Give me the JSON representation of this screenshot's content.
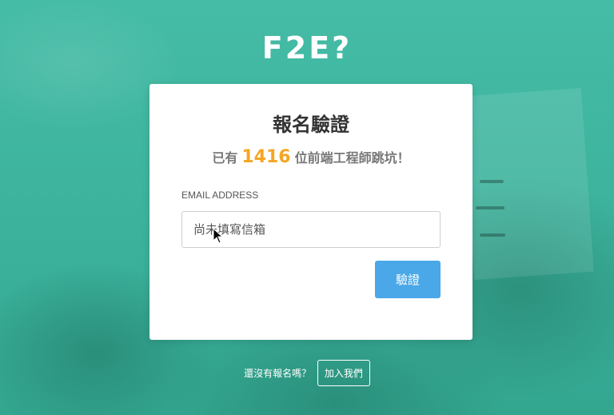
{
  "brand": {
    "logo_text": "F2E?"
  },
  "card": {
    "title": "報名驗證",
    "stats_prefix": "已有",
    "stats_count": "1416",
    "stats_suffix": "位前端工程師跳坑！",
    "email_label": "EMAIL ADDRESS",
    "email_placeholder": "尚未填寫信箱",
    "email_value": "",
    "verify_label": "驗證"
  },
  "footer": {
    "question": "還沒有報名嗎？",
    "join_label": "加入我們"
  },
  "colors": {
    "background": "#3fb59f",
    "accent_count": "#f5a623",
    "button": "#4aa8e8"
  }
}
